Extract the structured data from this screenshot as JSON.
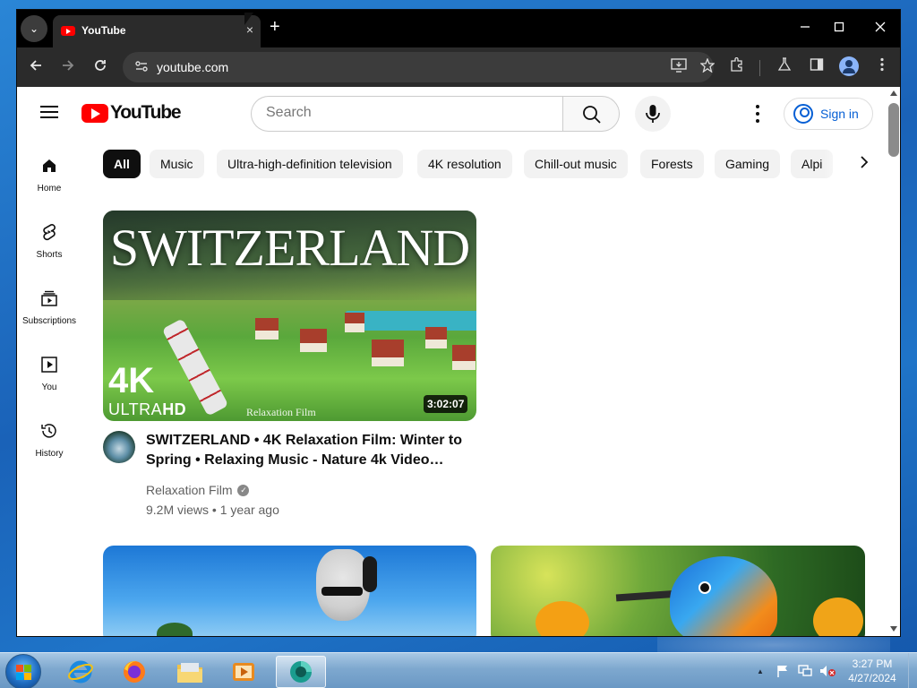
{
  "browser": {
    "tab_title": "YouTube",
    "url": "youtube.com",
    "new_tab_symbol": "+",
    "close_tab_symbol": "×"
  },
  "youtube": {
    "logo_text": "YouTube",
    "search": {
      "placeholder": "Search",
      "value": ""
    },
    "sign_in_label": "Sign in",
    "sidebar": [
      {
        "label": "Home",
        "icon": "home-icon"
      },
      {
        "label": "Shorts",
        "icon": "shorts-icon"
      },
      {
        "label": "Subscriptions",
        "icon": "subscriptions-icon"
      },
      {
        "label": "You",
        "icon": "you-icon"
      },
      {
        "label": "History",
        "icon": "history-icon"
      }
    ],
    "chips": [
      "All",
      "Music",
      "Ultra-high-definition television",
      "4K resolution",
      "Chill-out music",
      "Forests",
      "Gaming",
      "Alpi"
    ],
    "active_chip": "All",
    "videos": [
      {
        "thumbnail_title": "SWITZERLAND",
        "thumbnail_badge_4k": "4K",
        "thumbnail_badge_ultra": "ULTRA",
        "thumbnail_badge_hd": "HD",
        "thumbnail_watermark": "Relaxation Film",
        "duration": "3:02:07",
        "title": "SWITZERLAND • 4K Relaxation Film: Winter to Spring • Relaxing Music - Nature 4k Video…",
        "channel": "Relaxation Film",
        "verified": true,
        "meta": "9.2M views • 1 year ago"
      }
    ]
  },
  "taskbar": {
    "time": "3:27 PM",
    "date": "4/27/2024",
    "tray_arrow": "▲"
  },
  "colors": {
    "youtube_red": "#ff0000",
    "link_blue": "#065fd4",
    "chrome_dark": "#2b2b2b"
  }
}
